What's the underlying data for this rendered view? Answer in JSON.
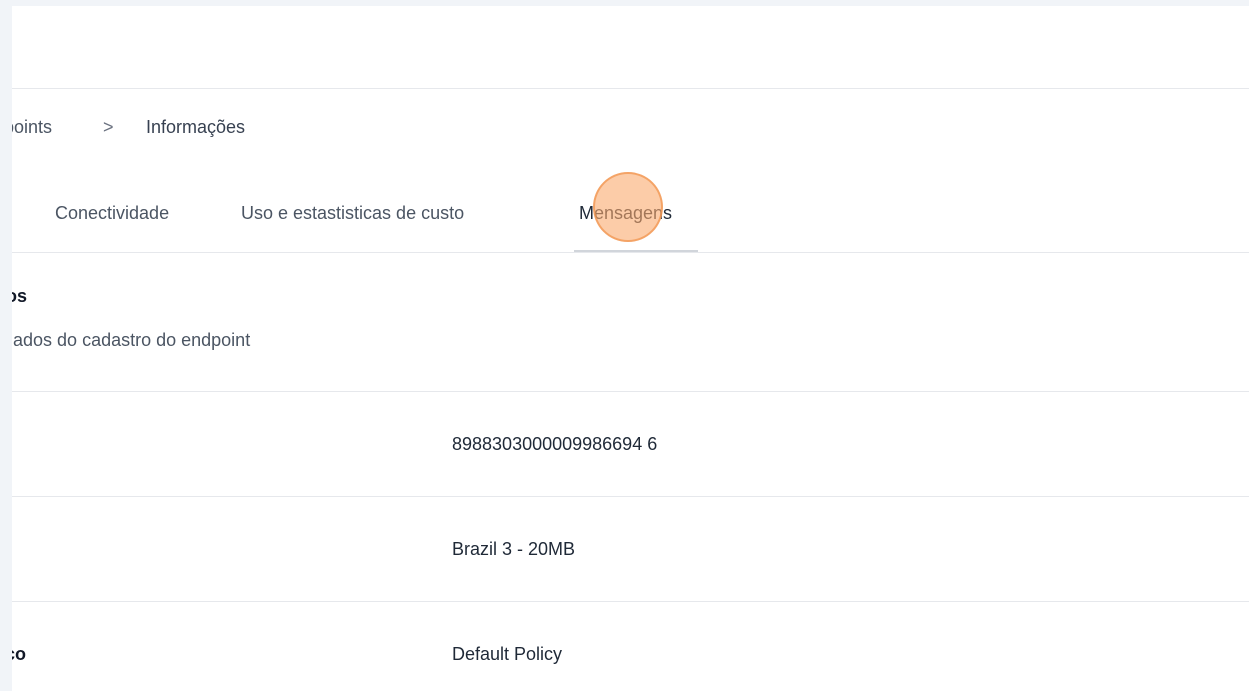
{
  "breadcrumb": {
    "previous": "points",
    "separator": ">",
    "current": "Informações"
  },
  "tabs": [
    {
      "label": "Conectividade"
    },
    {
      "label": "Uso e estastisticas de custo"
    },
    {
      "label": "Mensagens"
    }
  ],
  "section": {
    "title": "os",
    "subtitle": "dados do cadastro do endpoint"
  },
  "rows": [
    {
      "label": "",
      "value": "8988303000009986694 6"
    },
    {
      "label": "",
      "value": "Brazil 3 - 20MB"
    },
    {
      "label": "co",
      "value": "Default Policy"
    }
  ],
  "colors": {
    "click_marker": "#f9a86a",
    "divider": "#e6e8ec"
  }
}
